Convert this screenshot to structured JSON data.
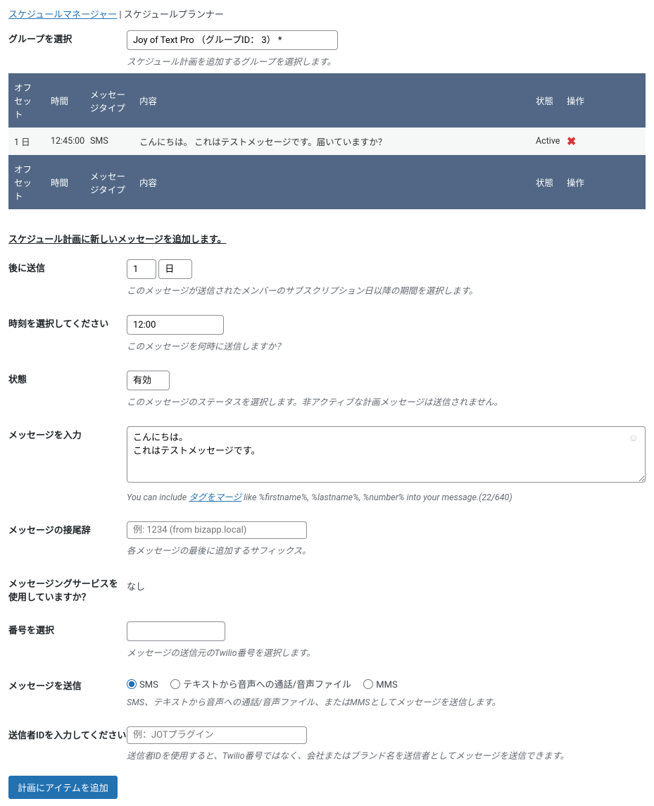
{
  "breadcrumb": {
    "link": "スケジュールマネージャー",
    "sep": "|",
    "current": "スケジュールプランナー"
  },
  "group": {
    "label": "グループを選択",
    "selected": "Joy of Text Pro （グループID： 3） *",
    "help": "スケジュール計画を追加するグループを選択します。"
  },
  "table": {
    "headers": {
      "offset": "オフセット",
      "time": "時間",
      "type": "メッセージタイプ",
      "content": "内容",
      "status": "状態",
      "action": "操作"
    },
    "rows": [
      {
        "offset": "1 日",
        "time": "12:45:00",
        "type": "SMS",
        "content": "こんにちは。 これはテストメッセージです。届いていますか？",
        "status": "Active"
      }
    ]
  },
  "subhead": "スケジュール計画に新しいメッセージを追加します。",
  "send_after": {
    "label": "後に送信",
    "num": "1",
    "unit": "日",
    "help": "このメッセージが送信されたメンバーのサブスクリプション日以降の期間を選択します。"
  },
  "select_time": {
    "label": "時刻を選択してください",
    "value": "12:00",
    "help": "このメッセージを何時に送信しますか？"
  },
  "status": {
    "label": "状態",
    "value": "有効",
    "help": "このメッセージのステータスを選択します。非アクティブな計画メッセージは送信されません。"
  },
  "message": {
    "label": "メッセージを入力",
    "value": "こんにちは。\nこれはテストメッセージです。",
    "help_pre": "You can include ",
    "help_link": "タグをマージ",
    "help_post": " like %firstname%, %lastname%, %number% into your message.(22/640)"
  },
  "suffix": {
    "label": "メッセージの接尾辞",
    "placeholder": "例: 1234 (from bizapp.local)",
    "help": "各メッセージの最後に追加するサフィックス。"
  },
  "msg_service": {
    "label": "メッセージングサービスを使用していますか？",
    "value": "なし"
  },
  "number": {
    "label": "番号を選択",
    "help": "メッセージの送信元のTwilio番号を選択します。"
  },
  "send_as": {
    "label": "メッセージを送信",
    "opts": {
      "sms": "SMS",
      "tts": "テキストから音声への通話/音声ファイル",
      "mms": "MMS"
    },
    "help": "SMS、テキストから音声への通話/音声ファイル、またはMMSとしてメッセージを送信します。"
  },
  "sender_id": {
    "label": "送信者IDを入力してください",
    "placeholder": "例：JOTプラグイン",
    "help": "送信者IDを使用すると、Twilio番号ではなく、会社またはブランド名を送信者としてメッセージを送信できます。"
  },
  "submit": "計画にアイテムを追加"
}
